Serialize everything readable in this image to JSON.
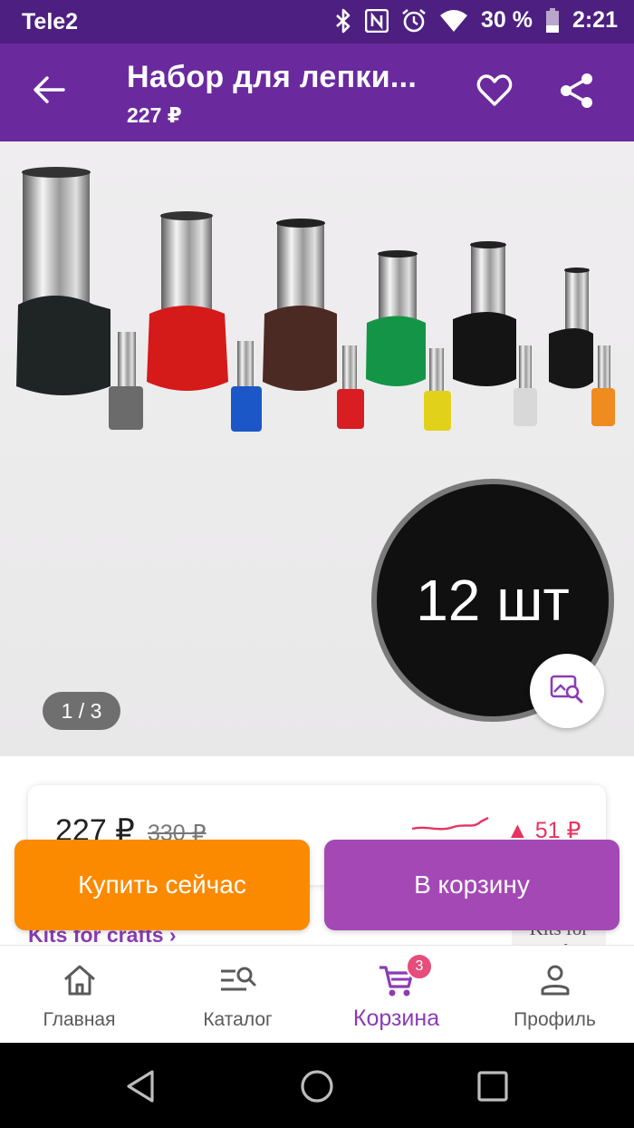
{
  "status_bar": {
    "carrier": "Tele2",
    "battery": "30 %",
    "time": "2:21"
  },
  "app_bar": {
    "title": "Набор для лепки...",
    "price": "227 ₽"
  },
  "gallery": {
    "overlay_text": "12 шт",
    "page_indicator": "1 / 3"
  },
  "price_card": {
    "current_price": "227 ₽",
    "old_price": "330 ₽",
    "price_change": "▲ 51 ₽"
  },
  "category": {
    "link_text": "Kits for crafts ›",
    "thumb_text": "Kits for crafts"
  },
  "actions": {
    "buy_now": "Купить сейчас",
    "add_to_cart": "В корзину"
  },
  "bottom_nav": {
    "items": [
      {
        "label": "Главная",
        "icon": "home-icon"
      },
      {
        "label": "Каталог",
        "icon": "catalog-search-icon"
      },
      {
        "label": "Корзина",
        "icon": "cart-icon",
        "badge": "3",
        "active": true
      },
      {
        "label": "Профиль",
        "icon": "profile-icon"
      }
    ]
  },
  "colors": {
    "status_bar": "#4d1f80",
    "app_bar": "#6a2a9e",
    "buy_button": "#fb8a00",
    "cart_button": "#a448b6",
    "active_nav": "#8b3cb4",
    "price_up": "#e63462"
  }
}
